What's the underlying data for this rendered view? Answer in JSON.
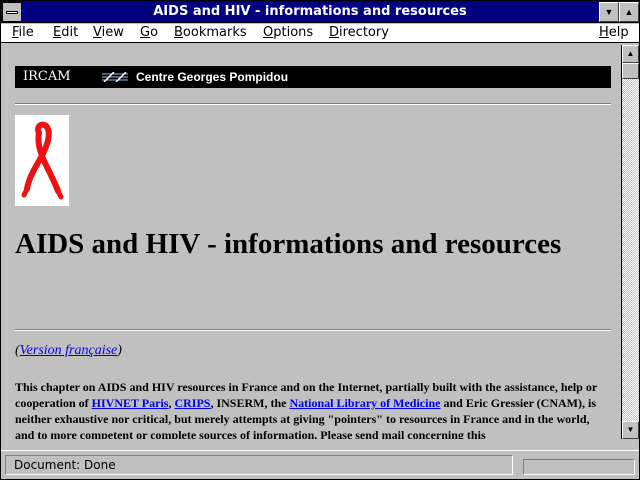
{
  "window": {
    "title": "AIDS and HIV - informations and resources",
    "minimize_glyph": "▼",
    "maximize_glyph": "▲"
  },
  "menu": {
    "items": [
      "File",
      "Edit",
      "View",
      "Go",
      "Bookmarks",
      "Options",
      "Directory",
      "Help"
    ]
  },
  "banner": {
    "left_text": "IRCAM",
    "right_text": "Centre Georges Pompidou"
  },
  "page": {
    "ribbon_image": "red-aids-ribbon",
    "heading": "AIDS and HIV - informations and resources",
    "version_open": "(",
    "version_link": "Version française",
    "version_close": ")",
    "paragraph": {
      "t1": "This chapter on AIDS and HIV resources in France and on the Internet, partially built with the assistance, help or cooperation of ",
      "link1": "HIVNET Paris",
      "t2": ", ",
      "link2": "CRIPS",
      "t3": ", INSERM, the ",
      "link3": "National Library of Medicine",
      "t4": " and Eric Gressier (CNAM), is neither exhaustive nor critical, but merely attempts at giving \"pointers\" to resources in France and in the world, and to more competent or complete sources of information. Please send mail concerning this"
    }
  },
  "scrollbar": {
    "up_glyph": "▲",
    "down_glyph": "▼",
    "position": 0
  },
  "status": {
    "text": "Document: Done"
  },
  "colors": {
    "titlebar": "#000080",
    "background": "#c0c0c0",
    "link": "#0000ee",
    "ribbon": "#ee1111"
  }
}
